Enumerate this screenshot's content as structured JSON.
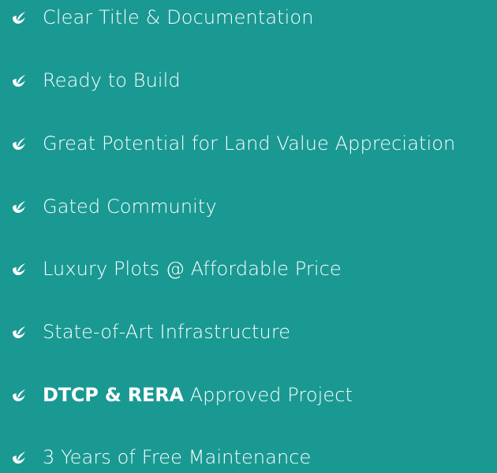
{
  "features": [
    {
      "text": "Clear Title & Documentation"
    },
    {
      "text": "Ready to Build"
    },
    {
      "text": "Great Potential for Land Value Appreciation"
    },
    {
      "text": "Gated Community"
    },
    {
      "text": "Luxury Plots @ Affordable Price"
    },
    {
      "text": "State-of-Art Infrastructure"
    },
    {
      "bold": "DTCP & RERA",
      "text": " Approved Project"
    },
    {
      "text": "3 Years of Free Maintenance"
    }
  ],
  "icon": "leaf-check-icon",
  "colors": {
    "background": "#1a9993",
    "text": "#ffffff"
  }
}
